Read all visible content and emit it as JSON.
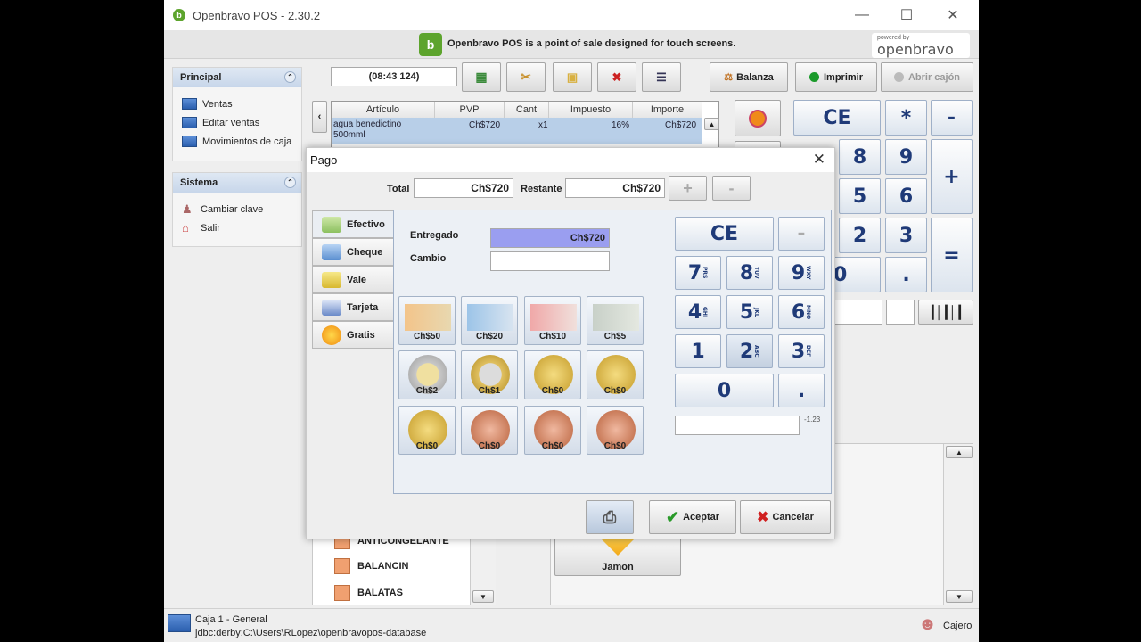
{
  "window": {
    "title": "Openbravo POS - 2.30.2",
    "logo_letter": "b"
  },
  "banner": {
    "text": "Openbravo POS is a point of sale designed for touch screens.",
    "powered_small": "powered by",
    "powered_big": "openbravo"
  },
  "sidebar": {
    "principal": {
      "title": "Principal",
      "items": [
        "Ventas",
        "Editar ventas",
        "Movimientos de caja"
      ]
    },
    "sistema": {
      "title": "Sistema",
      "items": [
        "Cambiar clave",
        "Salir"
      ]
    }
  },
  "toolbar": {
    "ticket_id": "(08:43 124)",
    "balanza": "Balanza",
    "imprimir": "Imprimir",
    "abrir_cajon": "Abrir cajón"
  },
  "ticket_table": {
    "headers": [
      "Artículo",
      "PVP",
      "Cant",
      "Impuesto",
      "Importe"
    ],
    "row": {
      "articulo": "agua benedictino 500mml",
      "pvp": "Ch$720",
      "cant": "x1",
      "impuesto": "16%",
      "importe": "Ch$720"
    }
  },
  "main_keypad": {
    "ce": "CE",
    "star": "*",
    "minus": "-",
    "plus": "+",
    "equals": "=",
    "dot": ".",
    "digits": [
      "8",
      "9",
      "5",
      "6",
      "2",
      "3"
    ],
    "partial_zero": "0"
  },
  "categories": [
    "ANTICONGELANTE",
    "BALANCIN",
    "BALATAS"
  ],
  "product": {
    "name": "Jamon"
  },
  "status": {
    "caja": "Caja 1 - General",
    "db": "jdbc:derby:C:\\Users\\RLopez\\openbravopos-database",
    "user": "Cajero"
  },
  "dialog": {
    "title": "Pago",
    "total_label": "Total",
    "total_value": "Ch$720",
    "restante_label": "Restante",
    "restante_value": "Ch$720",
    "plus_btn": "+",
    "minus_btn": "-",
    "tabs": [
      "Efectivo",
      "Cheque",
      "Vale",
      "Tarjeta",
      "Gratis"
    ],
    "entregado_label": "Entregado",
    "entregado_value": "Ch$720",
    "cambio_label": "Cambio",
    "cambio_value": "",
    "notes": [
      "Ch$50",
      "Ch$20",
      "Ch$10",
      "Ch$5"
    ],
    "coins_row1": [
      "Ch$2",
      "Ch$1",
      "Ch$0",
      "Ch$0"
    ],
    "coins_row2": [
      "Ch$0",
      "Ch$0",
      "Ch$0",
      "Ch$0"
    ],
    "keypad": {
      "ce": "CE",
      "minus": "-",
      "keys": [
        {
          "d": "7",
          "s": "PRS"
        },
        {
          "d": "8",
          "s": "TUV"
        },
        {
          "d": "9",
          "s": "WXY"
        },
        {
          "d": "4",
          "s": "GHI"
        },
        {
          "d": "5",
          "s": "JKL"
        },
        {
          "d": "6",
          "s": "MNO"
        },
        {
          "d": "1",
          "s": ""
        },
        {
          "d": "2",
          "s": "ABC"
        },
        {
          "d": "3",
          "s": "DEF"
        }
      ],
      "zero": "0",
      "dot": ".",
      "display": "",
      "display_hint": "-1.23"
    },
    "accept": "Aceptar",
    "cancel": "Cancelar"
  },
  "colors": {
    "accent_blue": "#1f3a78",
    "selected_field": "#9a9ef0",
    "brand_green": "#5da42d"
  }
}
